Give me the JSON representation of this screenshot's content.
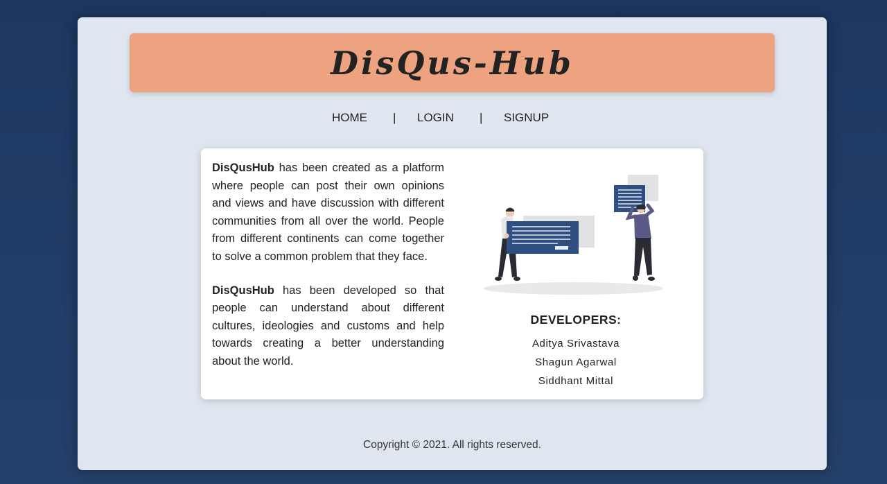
{
  "header": {
    "title": "DisQus-Hub"
  },
  "nav": {
    "home": "HOME",
    "separator": "|",
    "login": "LOGIN",
    "signup": "SIGNUP"
  },
  "about": {
    "p1_brand": "DisQusHub",
    "p1_text": " has been created as a platform where people can post their own opinions and views and have discussion with different communities from all over the world. People from different continents can come together to solve a common problem that they face.",
    "p2_brand": "DisQusHub",
    "p2_text": " has been developed so that people can understand about different cultures, ideologies and customs and help towards creating a better understanding about the world."
  },
  "developers": {
    "heading": "DEVELOPERS:",
    "names": [
      "Aditya Srivastava",
      "Shagun Agarwal",
      "Siddhant Mittal"
    ]
  },
  "footer": {
    "copyright": "Copyright © 2021. All rights reserved."
  },
  "colors": {
    "background": "#1d3761",
    "card": "#e0e6ef",
    "banner": "#eea380",
    "illustration_accent": "#2f4f80"
  }
}
